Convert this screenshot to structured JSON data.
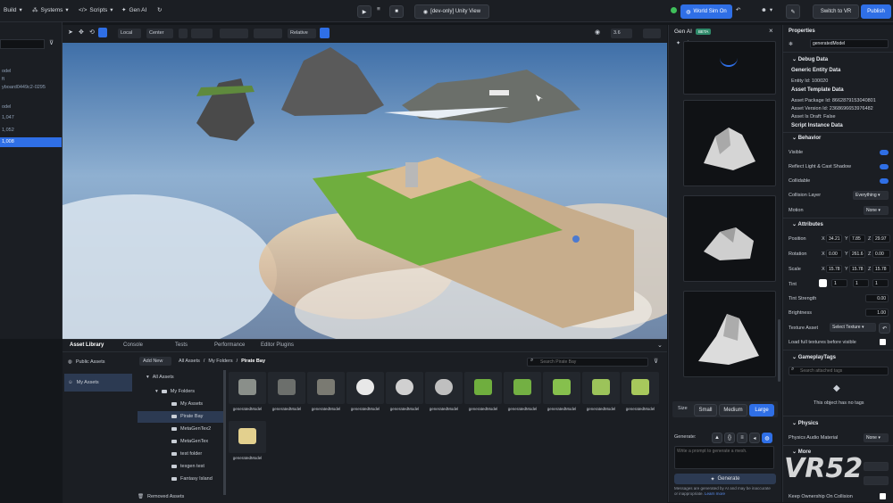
{
  "topbar": {
    "build": "Build",
    "systems": "Systems",
    "scripts": "Scripts",
    "gen_ai": "Gen AI",
    "play_title": "[dev-only] Unity View",
    "world_sim": "World Sim On",
    "switch_vr": "Switch to VR",
    "publish": "Publish"
  },
  "hierarchy": {
    "rows": [
      "odel",
      "ft",
      "yboard0449c2-0295",
      "odel",
      "1,047",
      "1,052",
      "1,008"
    ]
  },
  "viewport_toolbar": {
    "local": "Local",
    "center": "Center",
    "relative": "Relative",
    "zoom": "3.6"
  },
  "asset_library": {
    "tabs": [
      "Asset Library",
      "Console",
      "Tests",
      "Performance",
      "Editor Plugins"
    ],
    "nav": [
      "Public Assets",
      "My Assets"
    ],
    "add_new": "Add New",
    "breadcrumb": [
      "All Assets",
      "My Folders",
      "Pirate Bay"
    ],
    "search_placeholder": "Search Pirate Bay",
    "tree": [
      "All Assets",
      "My Folders",
      "My Assets",
      "Pirate Bay",
      "MetaGenTex2",
      "MetaGenTex",
      "test folder",
      "texgen test",
      "Fantasy Island"
    ],
    "removed": "Removed Assets",
    "items": [
      "generatedModel",
      "generatedModel",
      "generatedModel",
      "generatedModel",
      "generatedModel",
      "generatedModel",
      "generatedModel",
      "generatedModel",
      "generatedModel",
      "generatedModel",
      "generatedModel",
      "generatedModel"
    ]
  },
  "gen_ai": {
    "title": "Gen AI",
    "badge": "BETA",
    "size_label": "Size",
    "sizes": [
      "Small",
      "Medium",
      "Large"
    ],
    "generate_label": "Generate:",
    "prompt_placeholder": "Write a prompt to generate a mesh.",
    "generate_button": "Generate",
    "disclaimer": "Messages are generated by AI and may be inaccurate or inappropriate.",
    "learn_more": "Learn more"
  },
  "properties": {
    "title": "Properties",
    "name": "generatedModel",
    "debug": "Debug Data",
    "generic_entity": "Generic Entity Data",
    "entity_id": "Entity Id: 100020",
    "asset_template": "Asset Template Data",
    "package_id": "Asset Package Id: 8662879153040801",
    "version_id": "Asset Version Id: 2368696653976482",
    "is_draft": "Asset Is Draft: False",
    "script_instance": "Script Instance Data",
    "behavior": "Behavior",
    "visible": "Visible",
    "reflect": "Reflect Light & Cast Shadow",
    "collidable": "Collidable",
    "collision_layer": "Collision Layer",
    "collision_value": "Everything",
    "motion": "Motion",
    "motion_value": "None",
    "attributes": "Attributes",
    "position": "Position",
    "pos": [
      "34.21",
      "7.85",
      "29.97"
    ],
    "rotation": "Rotation",
    "rot": [
      "0.00",
      "261.6",
      "0.00"
    ],
    "scale": "Scale",
    "scl": [
      "15.78",
      "15.78",
      "15.78"
    ],
    "tint": "Tint",
    "tint_vals": [
      "1",
      "1",
      "1"
    ],
    "tint_strength": "Tint Strength",
    "tint_strength_val": "0.00",
    "brightness": "Brightness",
    "brightness_val": "1.00",
    "texture_asset": "Texture Asset",
    "select_texture": "Select Texture",
    "load_full": "Load full textures before visible",
    "gameplay_tags": "GameplayTags",
    "search_tags": "Search attached tags",
    "no_tags": "This object has no tags",
    "physics": "Physics",
    "physics_material": "Physics Audio Material",
    "physics_value": "None",
    "more": "More",
    "keep_ownership": "Keep Ownership On Collision"
  },
  "watermark": "VR52",
  "colors": {
    "accent": "#2f6fe6",
    "bg": "#1b1e23"
  }
}
